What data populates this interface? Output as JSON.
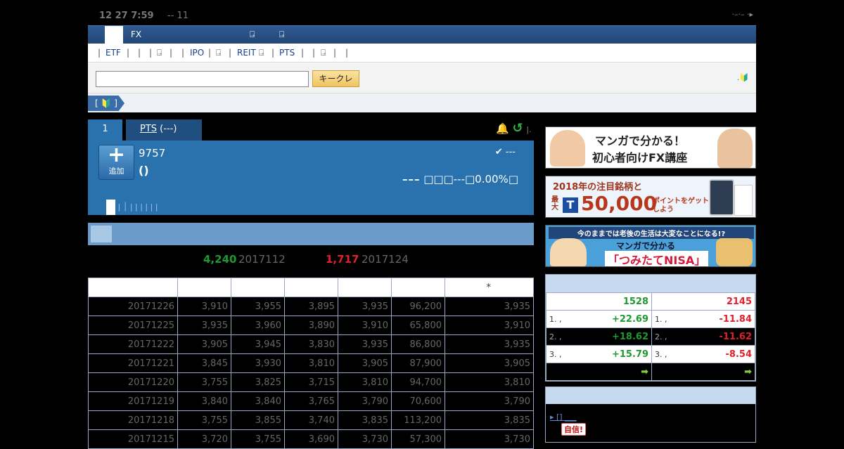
{
  "topbar": {
    "datetime": "12 27 7:59",
    "extra": "-- 11",
    "right": "·–·– ·▸"
  },
  "nav": {
    "fx": "FX",
    "ext_icon": "⍈"
  },
  "subnav": {
    "items": [
      "|",
      "ETF",
      "|",
      "|",
      "|",
      "⍈",
      "|",
      "|",
      "IPO",
      "|",
      "⍈",
      "|",
      "REIT",
      "⍈",
      "|",
      "PTS",
      "|",
      "|",
      "⍈",
      "|",
      "|"
    ]
  },
  "search": {
    "placeholder": "",
    "button_label": "キークレ",
    "beginner_icon": ".🔰"
  },
  "crumb": {
    "label": "[ 🔰 ]"
  },
  "tabs": {
    "tab1": "1",
    "tab2_underlined": "PTS",
    "tab2_rest": " (---)"
  },
  "tab_icons": {
    "bell": "🔔",
    "refresh": "↺",
    "more": "|."
  },
  "stock": {
    "add_label": "追加",
    "code": "9757",
    "name": "()",
    "market_status": "✔ ---",
    "price_dash": "–––",
    "price_change": "□□□---□0.00%□",
    "tabs_text": "| │ | | | | | |"
  },
  "hilo": {
    "high_value": "4,240",
    "high_date": "2017112",
    "low_value": "1,717",
    "low_date": "2017124"
  },
  "table": {
    "headers": [
      "",
      "",
      "",
      "",
      "",
      "",
      "*"
    ],
    "rows": [
      [
        "20171226",
        "3,910",
        "3,955",
        "3,895",
        "3,935",
        "96,200",
        "3,935"
      ],
      [
        "20171225",
        "3,935",
        "3,960",
        "3,890",
        "3,910",
        "65,800",
        "3,910"
      ],
      [
        "20171222",
        "3,905",
        "3,945",
        "3,830",
        "3,935",
        "86,800",
        "3,935"
      ],
      [
        "20171221",
        "3,845",
        "3,930",
        "3,810",
        "3,905",
        "87,900",
        "3,905"
      ],
      [
        "20171220",
        "3,755",
        "3,825",
        "3,715",
        "3,810",
        "94,700",
        "3,810"
      ],
      [
        "20171219",
        "3,840",
        "3,840",
        "3,765",
        "3,790",
        "70,600",
        "3,790"
      ],
      [
        "20171218",
        "3,755",
        "3,855",
        "3,740",
        "3,835",
        "113,200",
        "3,835"
      ],
      [
        "20171215",
        "3,720",
        "3,755",
        "3,690",
        "3,730",
        "57,300",
        "3,730"
      ]
    ]
  },
  "banners": {
    "b1_line1": "マンガで分かる！",
    "b1_line2": "初心者向けFX講座",
    "b2_line1": "2018年の注目銘柄と",
    "b2_prefix": "最大",
    "b2_amount": "50,000",
    "b2_suffix": "ポイントをゲットしよう",
    "b3_line1": "今のままでは老後の生活は大変なことになる!?",
    "b3_line2": "マンガで分かる",
    "b3_line3": "「つみたてNISA」"
  },
  "ranking": {
    "up_count": "1528",
    "down_count": "2145",
    "rows": [
      {
        "up_rank": "1. ,",
        "up_val": "+22.69",
        "down_rank": "1. ,",
        "down_val": "-11.84"
      },
      {
        "up_rank": "2. ,",
        "up_val": "+18.62",
        "down_rank": "2. ,",
        "down_val": "-11.62"
      },
      {
        "up_rank": "3. ,",
        "up_val": "+15.79",
        "down_rank": "3. ,",
        "down_val": "-8.54"
      }
    ],
    "more_icon": "➡"
  },
  "news": {
    "link": "▸ [] ___",
    "badge": "自信!"
  },
  "colors": {
    "accent_blue": "#2a72ad",
    "up": "#1f9a32",
    "down": "#e0202c"
  }
}
